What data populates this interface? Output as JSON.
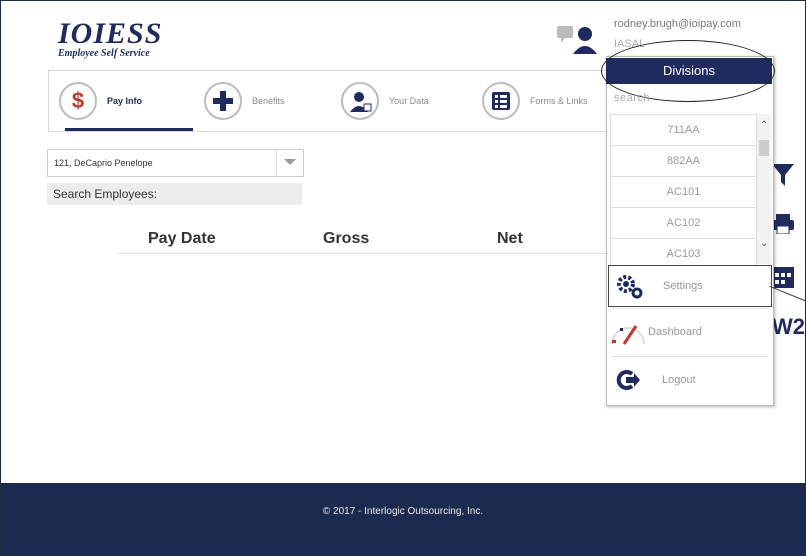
{
  "logo": {
    "title": "IOIESS",
    "subtitle": "Employee Self Service"
  },
  "header": {
    "email": "rodney.brugh@ioipay.com",
    "company": "IASAL"
  },
  "nav": {
    "tabs": [
      {
        "label": "Pay Info",
        "icon": "dollar-icon",
        "active": true
      },
      {
        "label": "Benefits",
        "icon": "plus-icon"
      },
      {
        "label": "Your Data",
        "icon": "user-chart-icon"
      },
      {
        "label": "Forms & Links",
        "icon": "list-icon"
      }
    ]
  },
  "employee": {
    "selected": "121, DeCaprio Penelope",
    "search_label": "Search Employees:"
  },
  "table": {
    "headers": [
      "Pay Date",
      "Gross",
      "Net"
    ]
  },
  "dropdown": {
    "title": "Divisions",
    "search_placeholder": "search",
    "divisions": [
      "711AA",
      "882AA",
      "AC101",
      "AC102",
      "AC103"
    ],
    "menu": [
      {
        "label": "Settings",
        "icon": "gears-icon"
      },
      {
        "label": "Dashboard",
        "icon": "gauge-icon"
      },
      {
        "label": "Logout",
        "icon": "logout-icon"
      }
    ]
  },
  "side_icons": [
    "filter-icon",
    "printer-icon",
    "calendar-icon",
    "w2-icon"
  ],
  "side_w2_text": "W2",
  "footer": {
    "text": "© 2017 - Interlogic Outsourcing, Inc."
  },
  "colors": {
    "brand": "#1f2a5e",
    "footer": "#1c2a4f",
    "accent": "#c0392b"
  }
}
